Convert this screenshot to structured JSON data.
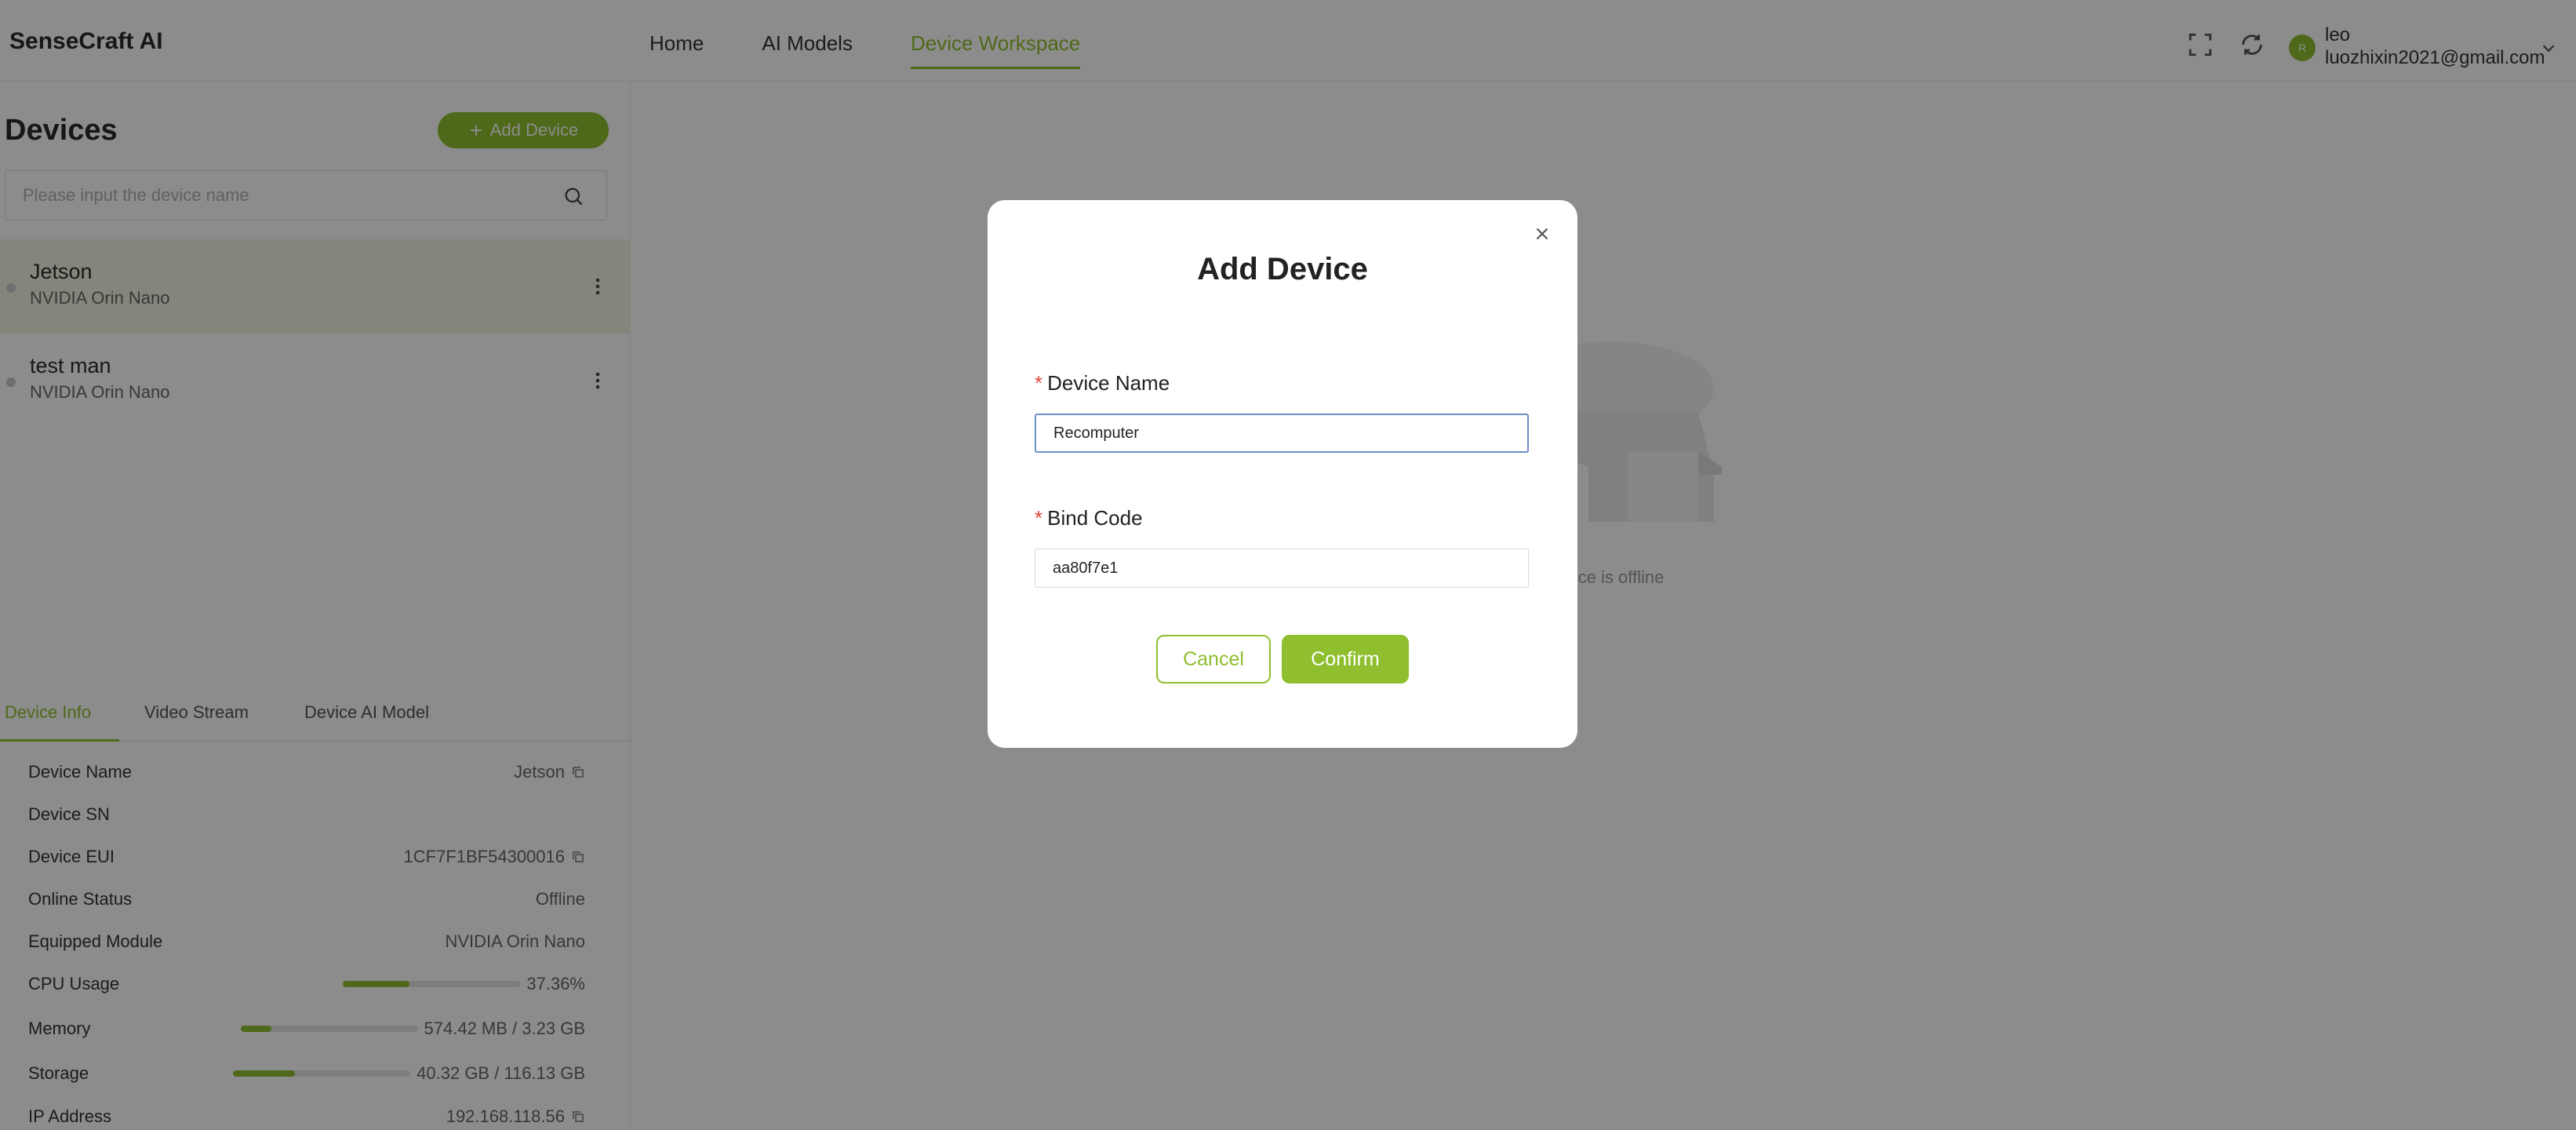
{
  "app": {
    "brand": "SenseCraft AI"
  },
  "nav": {
    "items": [
      {
        "label": "Home",
        "active": false
      },
      {
        "label": "AI Models",
        "active": false
      },
      {
        "label": "Device Workspace",
        "active": true
      }
    ]
  },
  "header": {
    "icons": [
      "fullscreen-icon",
      "refresh-icon"
    ],
    "user": {
      "avatar_initial": "R",
      "name": "leo",
      "email": "luozhixin2021@gmail.com"
    }
  },
  "sidebar": {
    "title": "Devices",
    "add_button": "Add Device",
    "search_placeholder": "Please input the device name",
    "devices": [
      {
        "name": "Jetson",
        "model": "NVIDIA Orin Nano",
        "selected": true
      },
      {
        "name": "test man",
        "model": "NVIDIA Orin Nano",
        "selected": false
      }
    ],
    "tabs": [
      "Device Info",
      "Video Stream",
      "Device AI Model"
    ],
    "info": {
      "device_name": {
        "label": "Device Name",
        "value": "Jetson"
      },
      "device_sn": {
        "label": "Device SN",
        "value": ""
      },
      "device_eui": {
        "label": "Device EUI",
        "value": "1CF7F1BF54300016"
      },
      "online_status": {
        "label": "Online Status",
        "value": "Offline"
      },
      "equipped_module": {
        "label": "Equipped Module",
        "value": "NVIDIA Orin Nano"
      },
      "cpu_usage": {
        "label": "CPU Usage",
        "value": "37.36%",
        "fraction": 0.3736
      },
      "memory": {
        "label": "Memory",
        "value": "574.42 MB / 3.23 GB",
        "fraction": 0.174
      },
      "storage": {
        "label": "Storage",
        "value": "40.32 GB / 116.13 GB",
        "fraction": 0.347
      },
      "ip_address": {
        "label": "IP Address",
        "value": "192.168.118.56"
      }
    }
  },
  "main": {
    "offline_text": "Device is offline"
  },
  "modal": {
    "title": "Add Device",
    "device_name_label": "Device Name",
    "device_name_value": "Recomputer",
    "bind_code_label": "Bind Code",
    "bind_code_value": "aa80f7e1",
    "cancel": "Cancel",
    "confirm": "Confirm"
  },
  "colors": {
    "accent": "#8fbf2e",
    "required": "#e0473c",
    "focus_border": "#6d8fc7"
  }
}
